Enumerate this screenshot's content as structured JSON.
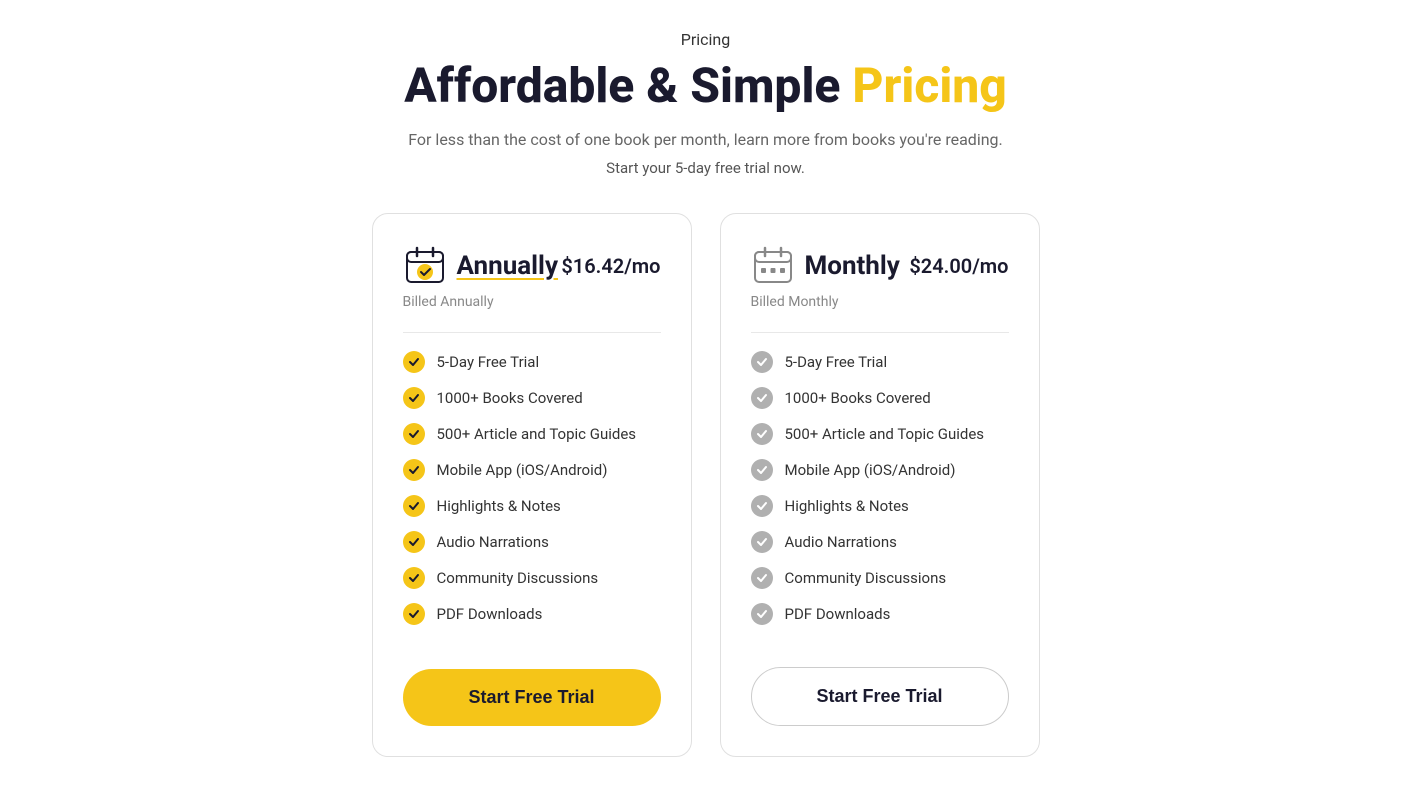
{
  "section_label": "Pricing",
  "headline_part1": "Affordable & Simple ",
  "headline_part2": "Pricing",
  "subtitle": "For less than the cost of one book per month, learn more from books you're reading.",
  "trial_note": "Start your 5-day free trial now.",
  "plans": [
    {
      "id": "annual",
      "title": "Annually",
      "price": "$16.42/mo",
      "billing": "Billed Annually",
      "icon_type": "annual",
      "features": [
        "5-Day Free Trial",
        "1000+ Books Covered",
        "500+ Article and Topic Guides",
        "Mobile App (iOS/Android)",
        "Highlights & Notes",
        "Audio Narrations",
        "Community Discussions",
        "PDF Downloads"
      ],
      "cta_label": "Start Free Trial",
      "cta_style": "primary"
    },
    {
      "id": "monthly",
      "title": "Monthly",
      "price": "$24.00/mo",
      "billing": "Billed Monthly",
      "icon_type": "monthly",
      "features": [
        "5-Day Free Trial",
        "1000+ Books Covered",
        "500+ Article and Topic Guides",
        "Mobile App (iOS/Android)",
        "Highlights & Notes",
        "Audio Narrations",
        "Community Discussions",
        "PDF Downloads"
      ],
      "cta_label": "Start Free Trial",
      "cta_style": "secondary"
    }
  ]
}
